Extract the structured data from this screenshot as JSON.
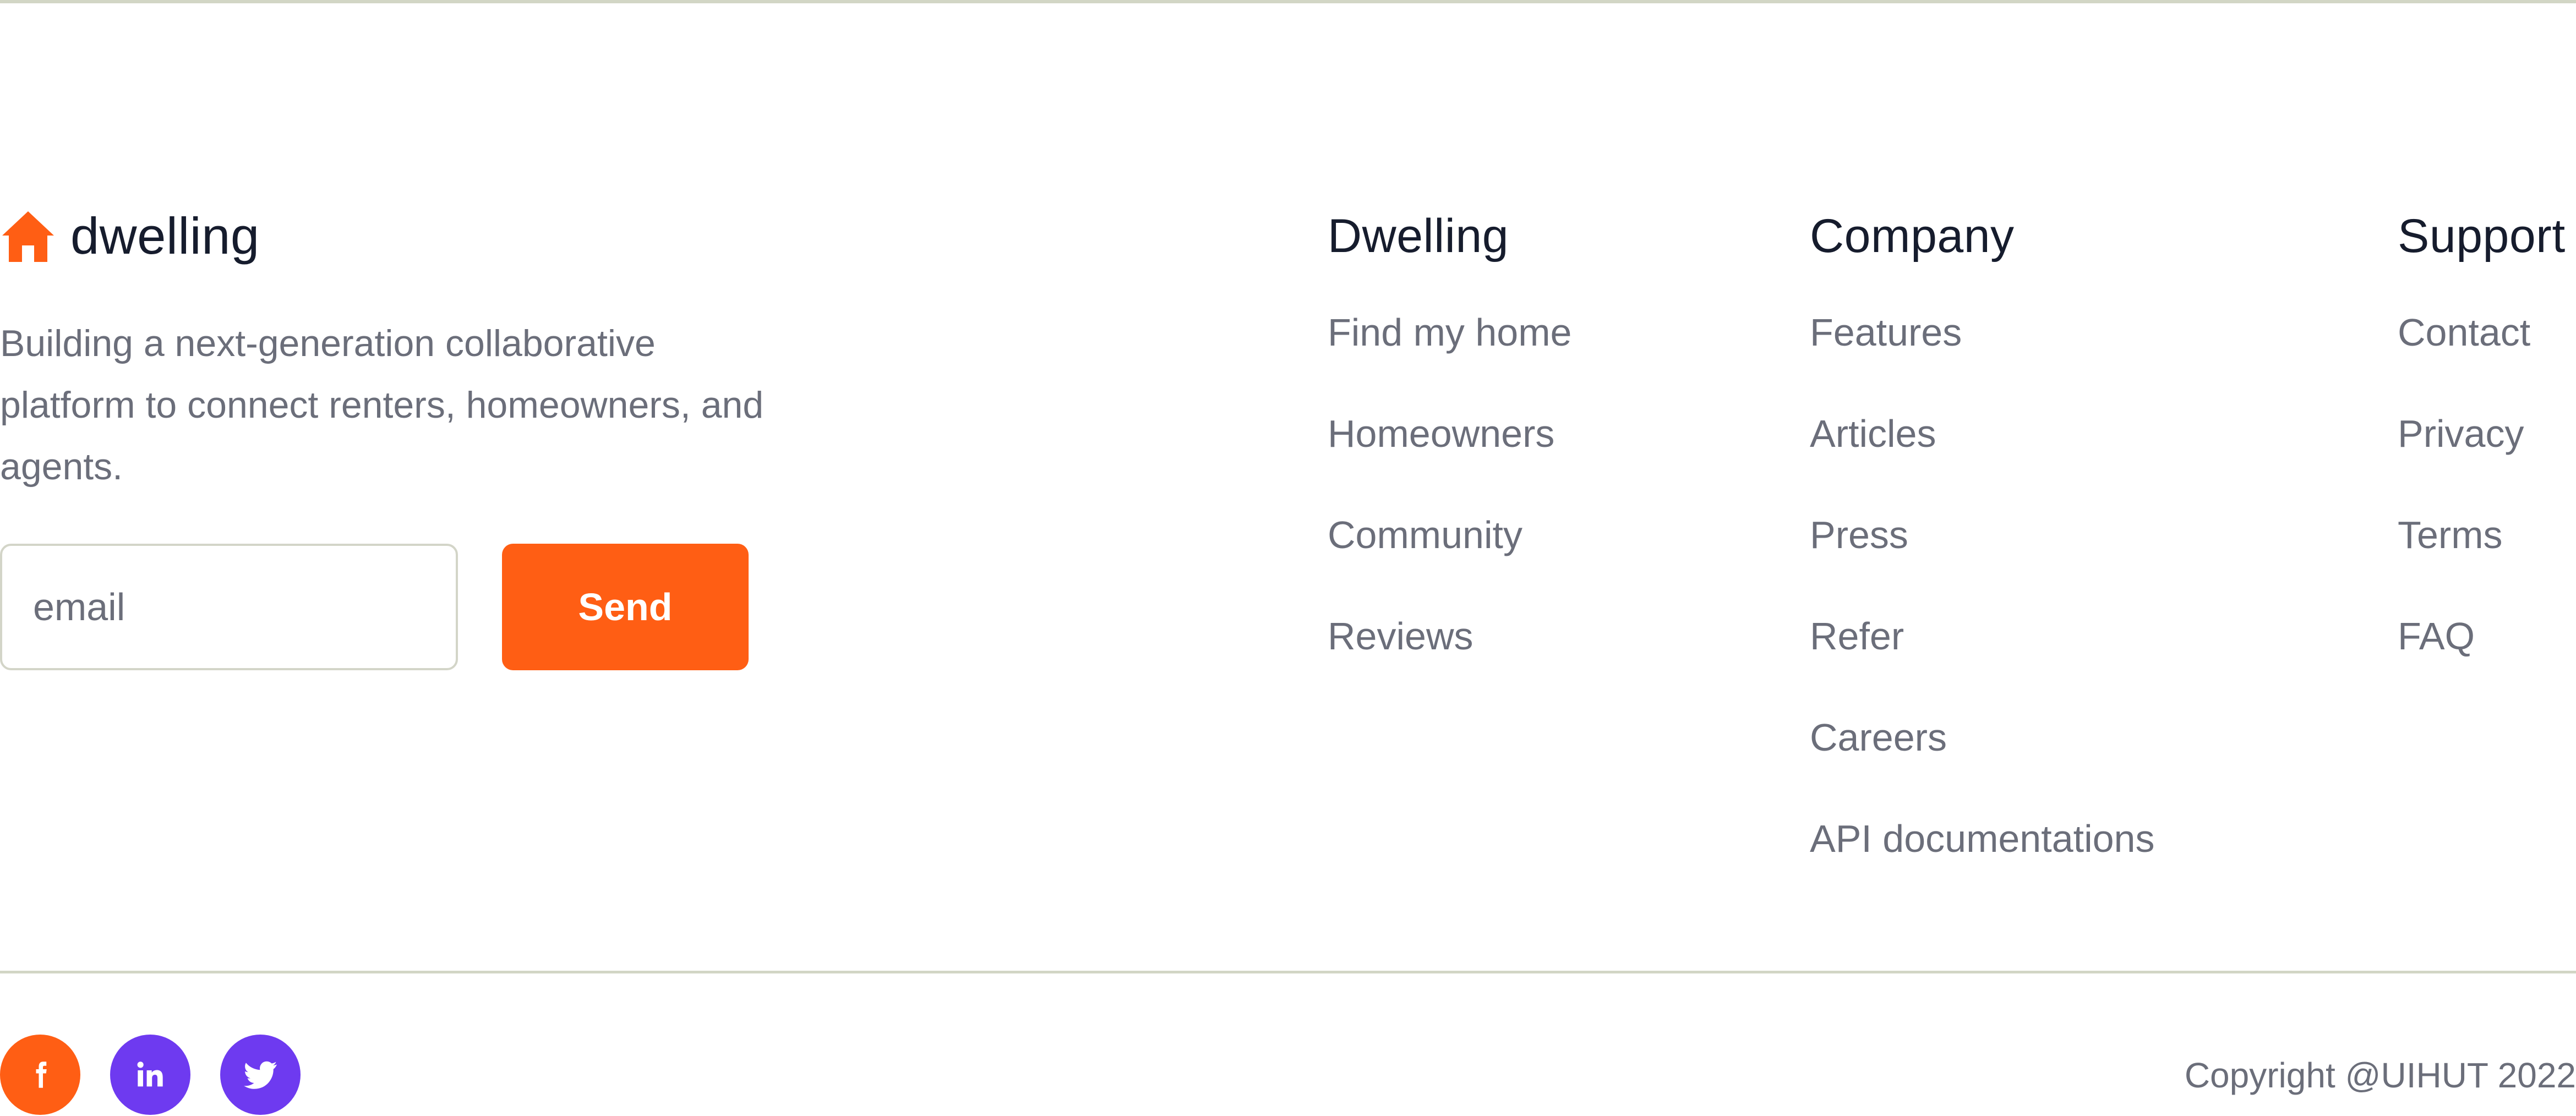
{
  "brand": {
    "name": "dwelling",
    "tagline": "Building a next-generation collaborative platform to connect renters, homeowners, and agents.",
    "icon": "house-icon",
    "accent_color": "#ff5e14"
  },
  "newsletter": {
    "email_placeholder": "email",
    "email_value": "",
    "send_label": "Send"
  },
  "columns": [
    {
      "title": "Dwelling",
      "links": [
        "Find my home",
        "Homeowners",
        "Community",
        "Reviews"
      ]
    },
    {
      "title": "Company",
      "links": [
        "Features",
        "Articles",
        "Press",
        "Refer",
        "Careers",
        "API documentations"
      ]
    },
    {
      "title": "Support",
      "links": [
        "Contact",
        "Privacy",
        "Terms",
        "FAQ"
      ]
    }
  ],
  "social": [
    {
      "icon": "facebook-icon",
      "color": "#ff5e14"
    },
    {
      "icon": "linkedin-icon",
      "color": "#6e3af0"
    },
    {
      "icon": "twitter-icon",
      "color": "#6e3af0"
    }
  ],
  "copyright": "Copyright @UIHUT 2022"
}
